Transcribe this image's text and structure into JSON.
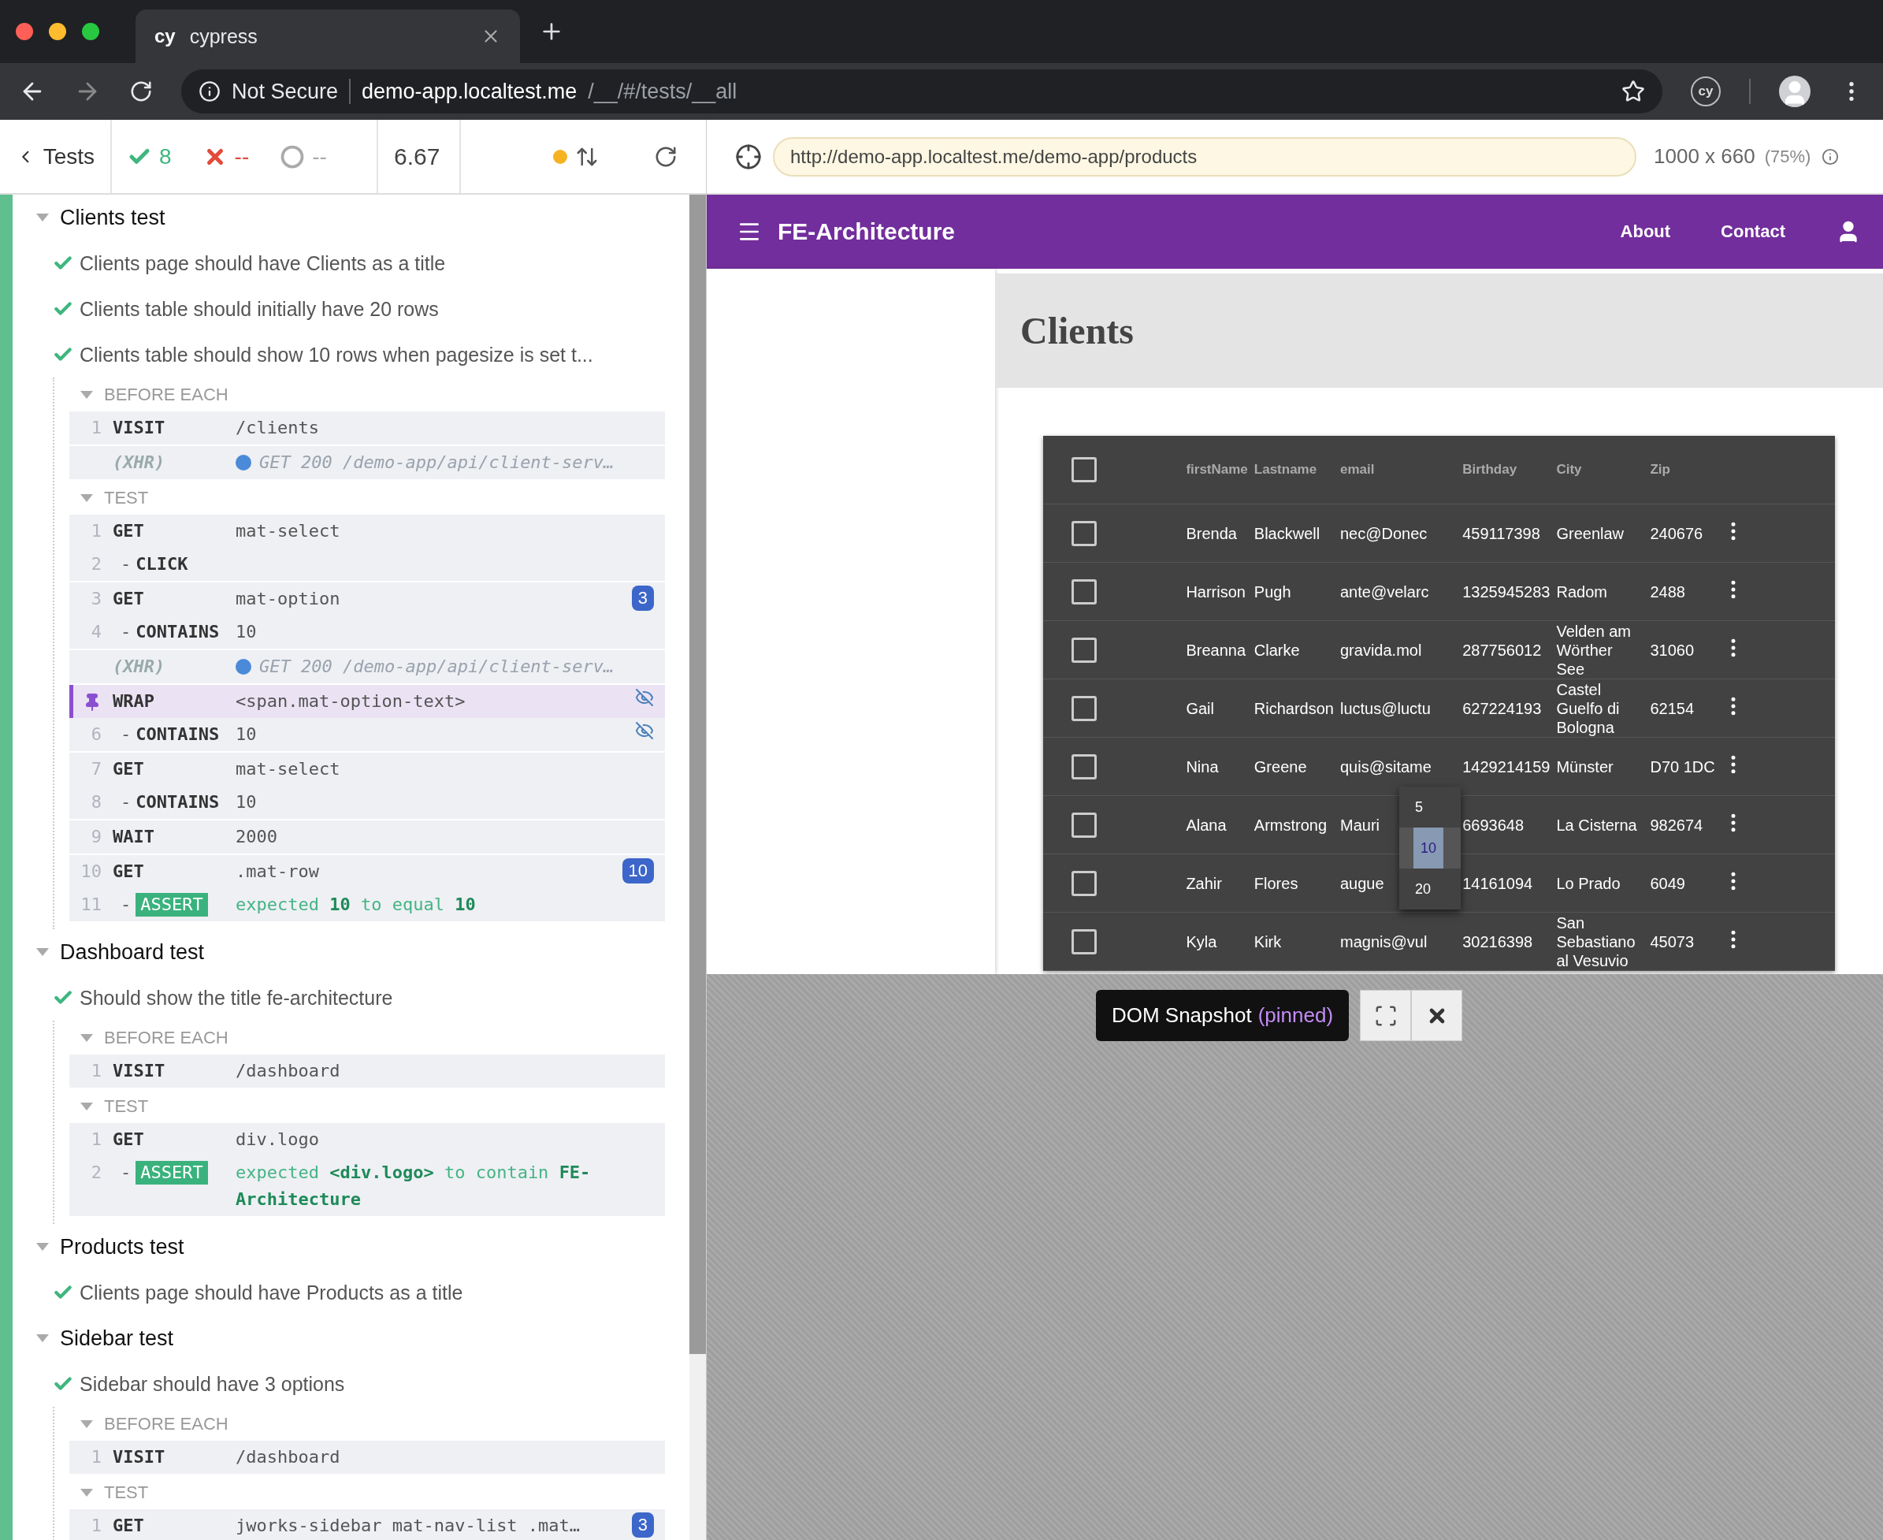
{
  "browser": {
    "tab": {
      "icon": "cy",
      "title": "cypress"
    },
    "address_bar": {
      "security": "Not Secure",
      "host": "demo-app.localtest.me",
      "path": "/__/#/tests/__all"
    },
    "extension": "cy"
  },
  "runner": {
    "back": "Tests",
    "passed": "8",
    "failed": "--",
    "pending": "--",
    "duration": "6.67",
    "url": "http://demo-app.localtest.me/demo-app/products",
    "viewport": "1000 x 660",
    "scale": "(75%)"
  },
  "reporter": {
    "suites": [
      {
        "title": "Clients test",
        "expanded": true,
        "tests": [
          {
            "title": "Clients page should have Clients as a title",
            "passed": true
          },
          {
            "title": "Clients table should initially have 20 rows",
            "passed": true
          },
          {
            "title": "Clients table should show 10 rows when pagesize is set t...",
            "passed": true,
            "hooks": [
              {
                "title": "BEFORE EACH",
                "expanded": true,
                "groups": [
                  [
                    {
                      "kind": "command",
                      "number": "1",
                      "name": "VISIT",
                      "message": "/clients",
                      "pinned": false,
                      "hidden": false
                    }
                  ],
                  [
                    {
                      "kind": "xhr",
                      "name": "(XHR)",
                      "message": "GET 200 /demo-app/api/client-serv…",
                      "pinned": false,
                      "hidden": false
                    }
                  ]
                ]
              },
              {
                "title": "TEST",
                "expanded": true,
                "groups": [
                  [
                    {
                      "kind": "command",
                      "number": "1",
                      "name": "GET",
                      "message": "mat-select",
                      "pinned": false,
                      "hidden": false
                    },
                    {
                      "kind": "command",
                      "number": "2",
                      "prefix": "-",
                      "name": "CLICK",
                      "pinned": false,
                      "hidden": false
                    }
                  ],
                  [
                    {
                      "kind": "command",
                      "number": "3",
                      "name": "GET",
                      "message": "mat-option",
                      "badge": "3",
                      "pinned": false,
                      "hidden": false
                    },
                    {
                      "kind": "command",
                      "number": "4",
                      "prefix": "-",
                      "name": "CONTAINS",
                      "message": "10",
                      "pinned": false,
                      "hidden": false
                    }
                  ],
                  [
                    {
                      "kind": "xhr",
                      "name": "(XHR)",
                      "message": "GET 200 /demo-app/api/client-serv…",
                      "pinned": false,
                      "hidden": false
                    }
                  ],
                  [
                    {
                      "kind": "command",
                      "name": "WRAP",
                      "message": "<span.mat-option-text>",
                      "pinned": true,
                      "hidden": true
                    },
                    {
                      "kind": "command",
                      "number": "6",
                      "prefix": "-",
                      "name": "CONTAINS",
                      "message": "10",
                      "pinned": false,
                      "hidden": true
                    }
                  ],
                  [
                    {
                      "kind": "command",
                      "number": "7",
                      "name": "GET",
                      "message": "mat-select",
                      "pinned": false,
                      "hidden": false
                    },
                    {
                      "kind": "command",
                      "number": "8",
                      "prefix": "-",
                      "name": "CONTAINS",
                      "message": "10",
                      "pinned": false,
                      "hidden": false
                    }
                  ],
                  [
                    {
                      "kind": "command",
                      "number": "9",
                      "name": "WAIT",
                      "message": "2000",
                      "pinned": false,
                      "hidden": false
                    }
                  ],
                  [
                    {
                      "kind": "command",
                      "number": "10",
                      "name": "GET",
                      "message": ".mat-row",
                      "badge": "10",
                      "pinned": false,
                      "hidden": false
                    },
                    {
                      "kind": "assert",
                      "number": "11",
                      "prefix": "-",
                      "name": "ASSERT",
                      "message": "expected **10** to equal **10**",
                      "pinned": false,
                      "hidden": false
                    }
                  ]
                ]
              }
            ]
          }
        ]
      },
      {
        "title": "Dashboard test",
        "expanded": true,
        "tests": [
          {
            "title": "Should show the title fe-architecture",
            "passed": true,
            "hooks": [
              {
                "title": "BEFORE EACH",
                "expanded": true,
                "groups": [
                  [
                    {
                      "kind": "command",
                      "number": "1",
                      "name": "VISIT",
                      "message": "/dashboard",
                      "pinned": false,
                      "hidden": false
                    }
                  ]
                ]
              },
              {
                "title": "TEST",
                "expanded": true,
                "groups": [
                  [
                    {
                      "kind": "command",
                      "number": "1",
                      "name": "GET",
                      "message": "div.logo",
                      "pinned": false,
                      "hidden": false
                    },
                    {
                      "kind": "assert",
                      "number": "2",
                      "prefix": "-",
                      "name": "ASSERT",
                      "message": "expected **<div.logo>** to contain **FE-Architecture**",
                      "pinned": false,
                      "hidden": false
                    }
                  ]
                ]
              }
            ]
          }
        ]
      },
      {
        "title": "Products test",
        "expanded": true,
        "tests": [
          {
            "title": "Clients page should have Products as a title",
            "passed": true
          }
        ]
      },
      {
        "title": "Sidebar test",
        "expanded": true,
        "tests": [
          {
            "title": "Sidebar should have 3 options",
            "passed": true,
            "hooks": [
              {
                "title": "BEFORE EACH",
                "expanded": true,
                "groups": [
                  [
                    {
                      "kind": "command",
                      "number": "1",
                      "name": "VISIT",
                      "message": "/dashboard",
                      "pinned": false,
                      "hidden": false
                    }
                  ]
                ]
              },
              {
                "title": "TEST",
                "expanded": true,
                "groups": [
                  [
                    {
                      "kind": "command",
                      "number": "1",
                      "name": "GET",
                      "message": "jworks-sidebar mat-nav-list .mat…",
                      "badge": "3",
                      "pinned": false,
                      "hidden": false
                    }
                  ]
                ]
              }
            ]
          }
        ]
      }
    ]
  },
  "app": {
    "brand": "FE-Architecture",
    "nav": [
      "About",
      "Contact"
    ],
    "title": "Clients",
    "table": {
      "columns": [
        "firstName",
        "Lastname",
        "email",
        "Birthday",
        "City",
        "Zip"
      ],
      "header_checked": false,
      "rows": [
        {
          "checked": false,
          "cells": [
            "Brenda",
            "Blackwell",
            "nec@Donec",
            "459117398",
            "Greenlaw",
            "240676"
          ]
        },
        {
          "checked": false,
          "cells": [
            "Harrison",
            "Pugh",
            "ante@velarc",
            "1325945283",
            "Radom",
            "2488"
          ]
        },
        {
          "checked": false,
          "cells": [
            "Breanna",
            "Clarke",
            "gravida.mol",
            "287756012",
            "Velden am Wörther See",
            "31060"
          ]
        },
        {
          "checked": false,
          "cells": [
            "Gail",
            "Richardson",
            "luctus@luctu",
            "627224193",
            "Castel Guelfo di Bologna",
            "62154"
          ]
        },
        {
          "checked": false,
          "cells": [
            "Nina",
            "Greene",
            "quis@sitame",
            "1429214159",
            "Münster",
            "D70 1DC"
          ]
        },
        {
          "checked": false,
          "cells": [
            "Alana",
            "Armstrong",
            "Mauri",
            "6693648",
            "La Cisterna",
            "982674"
          ]
        },
        {
          "checked": false,
          "cells": [
            "Zahir",
            "Flores",
            "augue",
            "14161094",
            "Lo Prado",
            "6049"
          ]
        },
        {
          "checked": false,
          "cells": [
            "Kyla",
            "Kirk",
            "magnis@vul",
            "30216398",
            "San Sebastiano al Vesuvio",
            "45073"
          ]
        }
      ]
    },
    "page_size_options": [
      {
        "label": "5",
        "selected": false
      },
      {
        "label": "10",
        "selected": true
      },
      {
        "label": "20",
        "selected": false
      }
    ]
  },
  "snapshot": {
    "label": "DOM Snapshot",
    "state": "(pinned)"
  }
}
